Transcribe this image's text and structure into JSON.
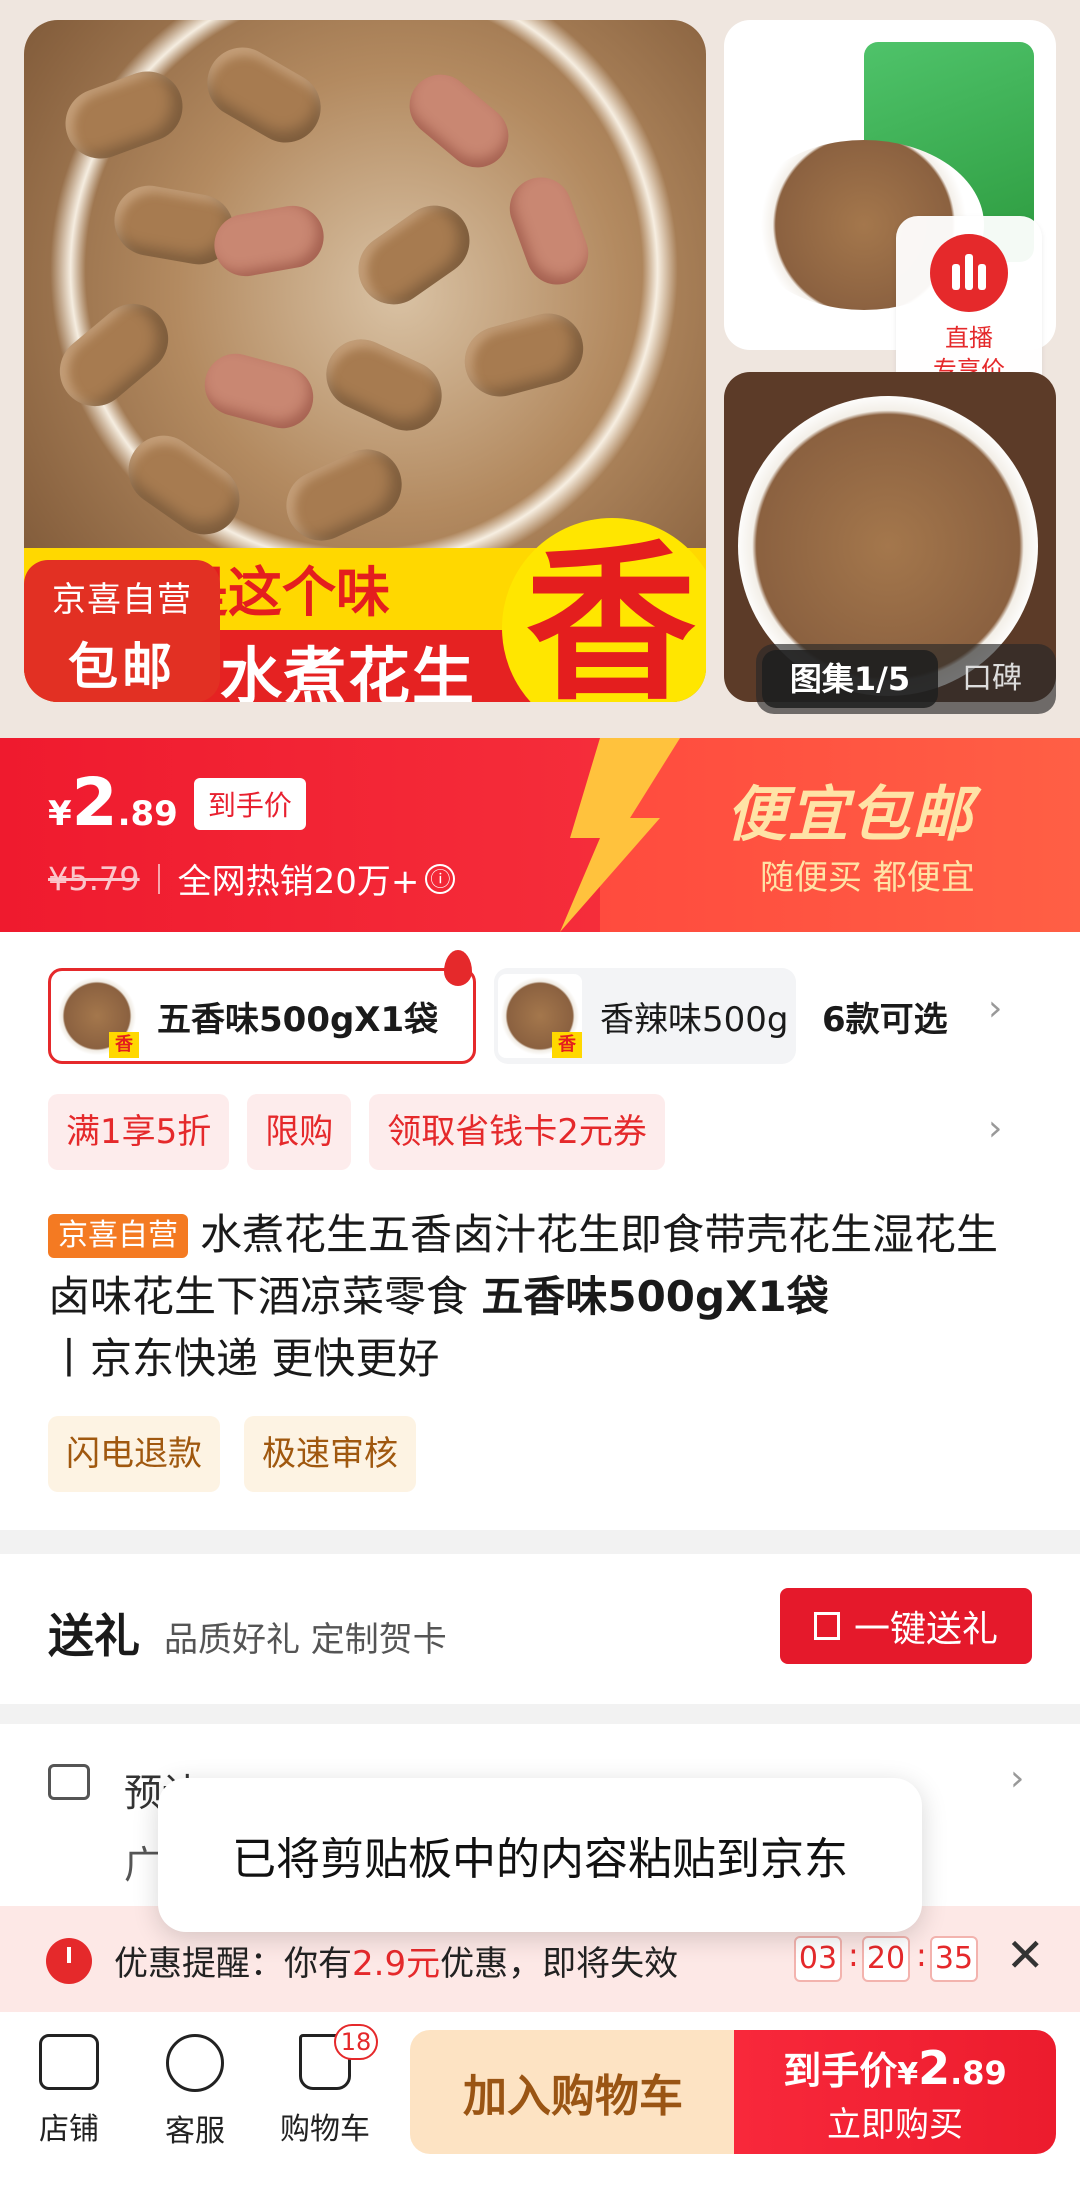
{
  "gallery": {
    "main_image": {
      "banner_top_text": "就是这个味",
      "banner_bottom_text": "水煮花生",
      "flavor_big_char": "香"
    },
    "badge": {
      "line1": "京喜自营",
      "line2": "包邮"
    },
    "live_badge": {
      "label_line1": "直播",
      "label_line2": "专享价"
    },
    "counter": "图集1/5",
    "koubei": "口碑"
  },
  "price_banner": {
    "currency": "¥",
    "price_int": "2",
    "price_dec": ".89",
    "price_tag": "到手价",
    "original_price": "¥5.79",
    "sales_text": "全网热销20万+",
    "info_icon": "ⓘ",
    "promo_title": "便宜包邮",
    "promo_sub": "随便买 都便宜"
  },
  "variants": {
    "selected": {
      "label": "五香味500gX1袋",
      "thumb_char": "香"
    },
    "other": {
      "label": "香辣味500g",
      "thumb_char": "香"
    },
    "count": "6款可选"
  },
  "coupons": [
    "满1享5折",
    "限购",
    "领取省钱卡2元券"
  ],
  "product": {
    "store_tag": "京喜自营",
    "title_text": "水煮花生五香卤汁花生即食带壳花生湿花生卤味花生下酒凉菜零食 ",
    "title_bold": "五香味500gX1袋",
    "title_tail": "丨京东快递 更快更好"
  },
  "features": [
    "闪电退款",
    "极速审核"
  ],
  "gift": {
    "heading": "送礼",
    "sub": "品质好礼 定制贺卡",
    "button": "一键送礼"
  },
  "shipping": {
    "line1": "预计",
    "line2": "广"
  },
  "toast": "已将剪贴板中的内容粘贴到京东",
  "reminder": {
    "prefix": "优惠提醒：你有",
    "amount": "2.9元",
    "suffix": "优惠，即将失效",
    "hh": "03",
    "mm": "20",
    "ss": "35",
    "close": "✕"
  },
  "bottom_bar": {
    "store": "店铺",
    "service": "客服",
    "cart": "购物车",
    "cart_count": "18",
    "add_to_cart": "加入购物车",
    "buy_label": "到手价",
    "buy_currency": "¥",
    "buy_price_int": "2",
    "buy_price_dec": ".89",
    "buy_now": "立即购买"
  },
  "colors": {
    "accent": "#e5292b",
    "promo_gold": "#ffe3a6",
    "add_cart_bg": "#fde3c3"
  }
}
